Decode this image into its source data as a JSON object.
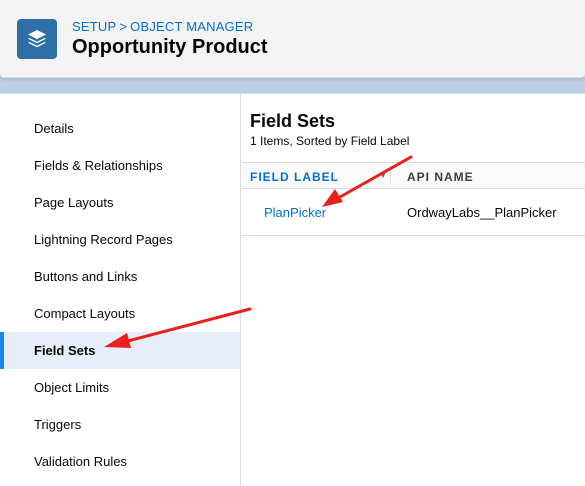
{
  "header": {
    "breadcrumb": [
      "SETUP",
      "OBJECT MANAGER"
    ],
    "breadcrumb_sep": ">",
    "title": "Opportunity Product",
    "icon": "stack-layers-icon"
  },
  "sidebar": {
    "items": [
      {
        "label": "Details",
        "active": false
      },
      {
        "label": "Fields & Relationships",
        "active": false
      },
      {
        "label": "Page Layouts",
        "active": false
      },
      {
        "label": "Lightning Record Pages",
        "active": false
      },
      {
        "label": "Buttons and Links",
        "active": false
      },
      {
        "label": "Compact Layouts",
        "active": false
      },
      {
        "label": "Field Sets",
        "active": true
      },
      {
        "label": "Object Limits",
        "active": false
      },
      {
        "label": "Triggers",
        "active": false
      },
      {
        "label": "Validation Rules",
        "active": false
      }
    ]
  },
  "main": {
    "title": "Field Sets",
    "subtitle": "1 Items, Sorted by Field Label",
    "columns": [
      "FIELD LABEL",
      "API NAME"
    ],
    "rows": [
      {
        "field_label": "PlanPicker",
        "api_name": "OrdwayLabs__PlanPicker"
      }
    ]
  },
  "colors": {
    "accent": "#0070d2",
    "header_icon_bg": "#2e6fa8",
    "active_item_bg": "#e7eef9",
    "annotation_arrow": "#e8201e"
  }
}
